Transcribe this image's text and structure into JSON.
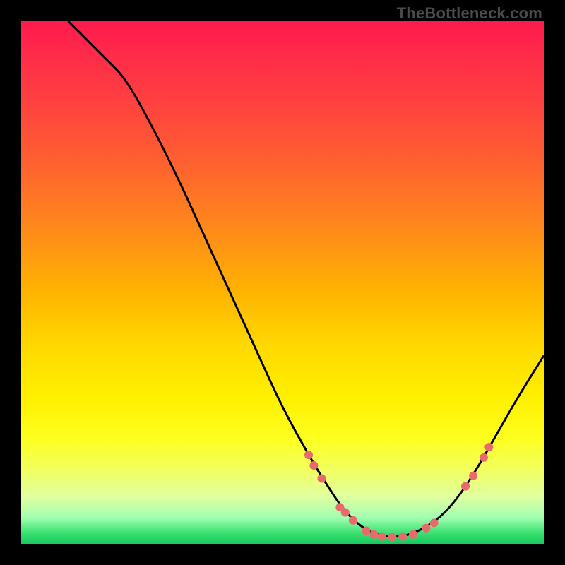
{
  "watermark": "TheBottleneck.com",
  "chart_data": {
    "type": "line",
    "title": "",
    "xlabel": "",
    "ylabel": "",
    "xlim": [
      0,
      100
    ],
    "ylim": [
      0,
      100
    ],
    "curve": [
      {
        "x": 9,
        "y": 100
      },
      {
        "x": 12,
        "y": 97
      },
      {
        "x": 16,
        "y": 93
      },
      {
        "x": 20,
        "y": 89
      },
      {
        "x": 25,
        "y": 80
      },
      {
        "x": 30,
        "y": 70
      },
      {
        "x": 35,
        "y": 59
      },
      {
        "x": 40,
        "y": 48
      },
      {
        "x": 45,
        "y": 37
      },
      {
        "x": 50,
        "y": 26
      },
      {
        "x": 55,
        "y": 17
      },
      {
        "x": 58,
        "y": 12
      },
      {
        "x": 62,
        "y": 6
      },
      {
        "x": 66,
        "y": 2.5
      },
      {
        "x": 70,
        "y": 1.3
      },
      {
        "x": 74,
        "y": 1.5
      },
      {
        "x": 79,
        "y": 4
      },
      {
        "x": 83,
        "y": 8
      },
      {
        "x": 87,
        "y": 14
      },
      {
        "x": 91,
        "y": 21
      },
      {
        "x": 95,
        "y": 28
      },
      {
        "x": 100,
        "y": 36
      }
    ],
    "markers": [
      {
        "x": 55.0,
        "y": 17.0
      },
      {
        "x": 56.0,
        "y": 15.0
      },
      {
        "x": 57.5,
        "y": 12.5
      },
      {
        "x": 61.0,
        "y": 7.0
      },
      {
        "x": 62.0,
        "y": 6.0
      },
      {
        "x": 63.5,
        "y": 4.5
      },
      {
        "x": 66.0,
        "y": 2.5
      },
      {
        "x": 67.5,
        "y": 1.8
      },
      {
        "x": 69.0,
        "y": 1.4
      },
      {
        "x": 71.0,
        "y": 1.3
      },
      {
        "x": 73.0,
        "y": 1.4
      },
      {
        "x": 75.0,
        "y": 1.8
      },
      {
        "x": 77.5,
        "y": 3.0
      },
      {
        "x": 79.0,
        "y": 4.0
      },
      {
        "x": 85.0,
        "y": 11.0
      },
      {
        "x": 86.5,
        "y": 13.0
      },
      {
        "x": 88.5,
        "y": 16.5
      },
      {
        "x": 89.5,
        "y": 18.5
      }
    ],
    "marker_color": "#e86a6a",
    "marker_radius": 6,
    "line_color": "#000000",
    "line_width": 3
  }
}
